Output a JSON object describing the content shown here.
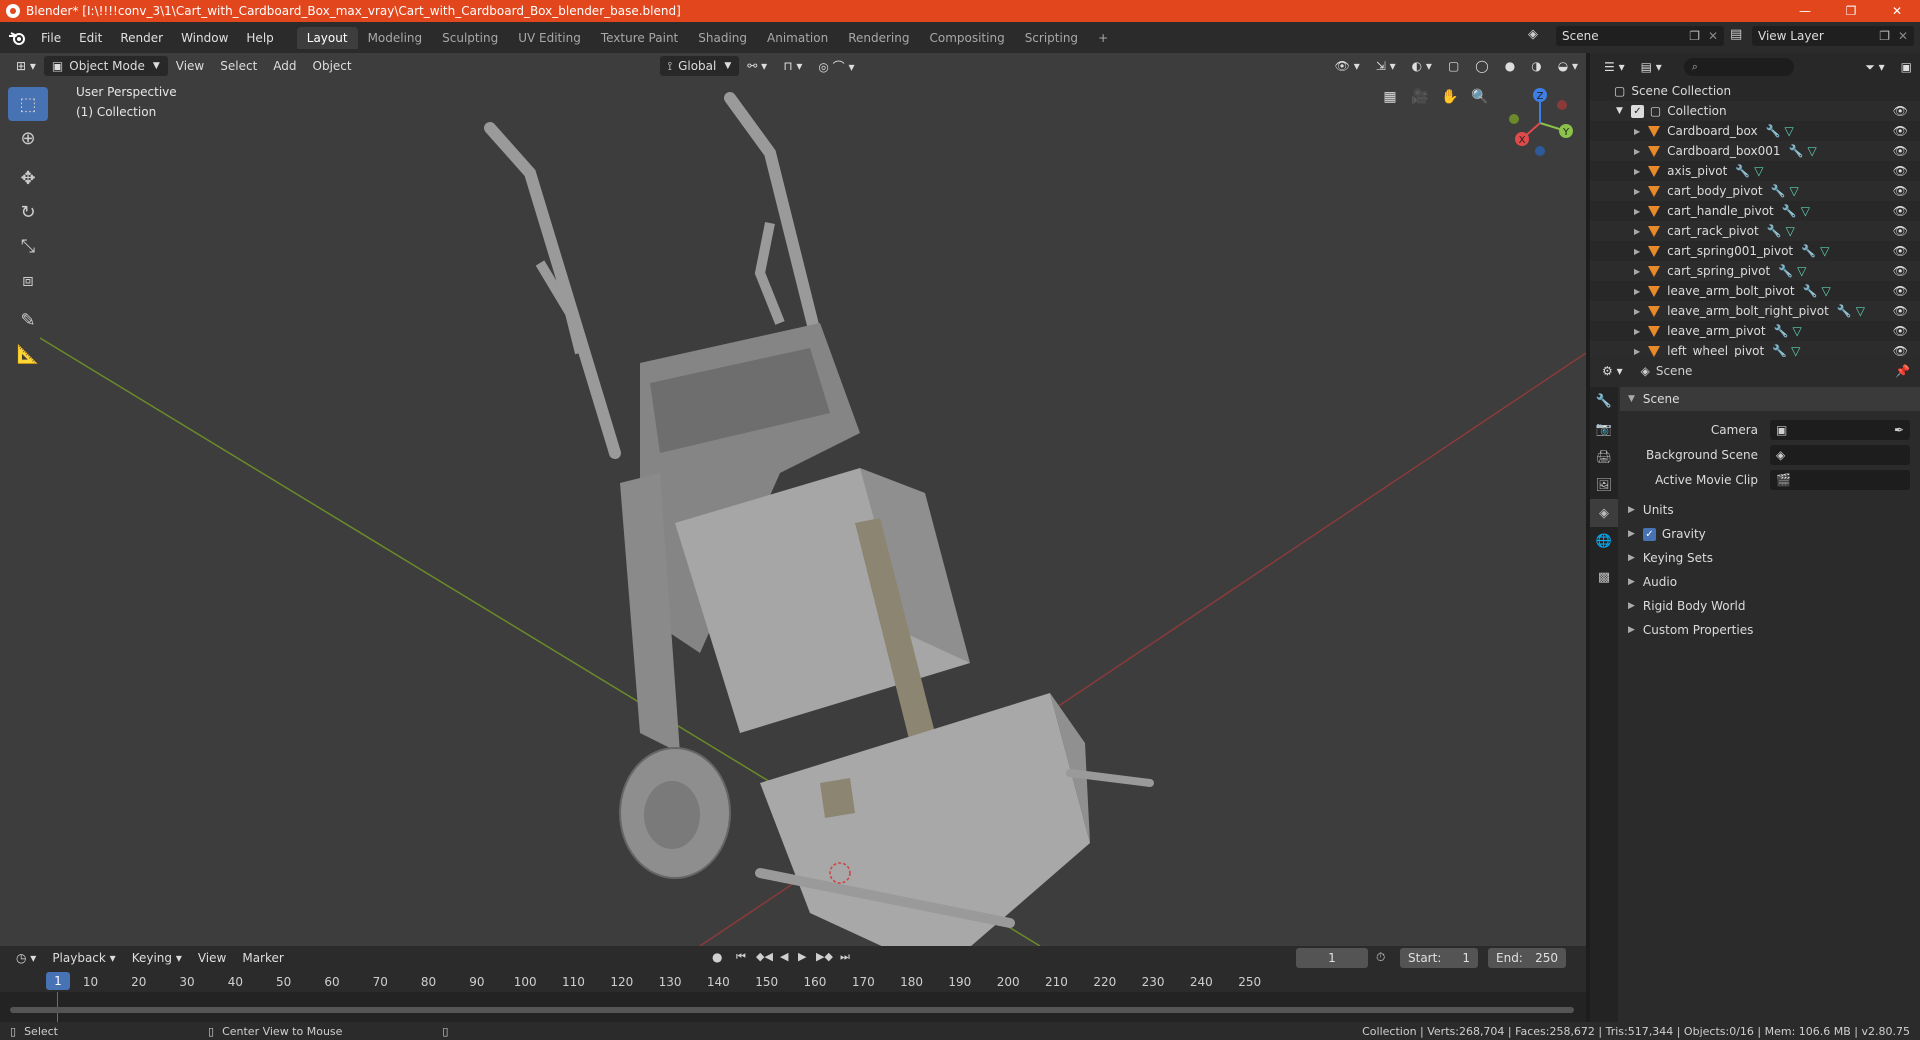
{
  "window": {
    "title": "Blender* [I:\\!!!!conv_3\\1\\Cart_with_Cardboard_Box_max_vray\\Cart_with_Cardboard_Box_blender_base.blend]",
    "minimize": "—",
    "maximize": "❐",
    "close": "✕"
  },
  "menu": [
    "File",
    "Edit",
    "Render",
    "Window",
    "Help"
  ],
  "workspaces": [
    "Layout",
    "Modeling",
    "Sculpting",
    "UV Editing",
    "Texture Paint",
    "Shading",
    "Animation",
    "Rendering",
    "Compositing",
    "Scripting"
  ],
  "scene_selector": "Scene",
  "view_layer_selector": "View Layer",
  "viewport": {
    "mode": "Object Mode",
    "menus": [
      "View",
      "Select",
      "Add",
      "Object"
    ],
    "orientation": "Global",
    "perspective": "User Perspective",
    "collection": "(1) Collection",
    "gizmo_axes": {
      "x": "X",
      "y": "Y",
      "z": "Z"
    },
    "colors": {
      "bg": "#3d3d3d",
      "grid_x": "#8a3a3a",
      "grid_y": "#6b8a2a",
      "model": "#9a9a9a",
      "active_tool": "#4772b3"
    }
  },
  "timeline": {
    "menus": [
      "Playback",
      "Keying",
      "View",
      "Marker"
    ],
    "current_frame": "1",
    "start_label": "Start:",
    "start": "1",
    "end_label": "End:",
    "end": "250",
    "ruler": [
      "1",
      "10",
      "20",
      "30",
      "40",
      "50",
      "60",
      "70",
      "80",
      "90",
      "100",
      "110",
      "120",
      "130",
      "140",
      "150",
      "160",
      "170",
      "180",
      "190",
      "200",
      "210",
      "220",
      "230",
      "240",
      "250"
    ]
  },
  "status": {
    "left_action": "Select",
    "middle_action": "Center View to Mouse",
    "stats": "Collection | Verts:268,704 | Faces:258,672 | Tris:517,344 | Objects:0/16 | Mem: 106.6 MB | v2.80.75"
  },
  "outliner": {
    "scene_collection": "Scene Collection",
    "collection": "Collection",
    "items": [
      "Cardboard_box",
      "Cardboard_box001",
      "axis_pivot",
      "cart_body_pivot",
      "cart_handle_pivot",
      "cart_rack_pivot",
      "cart_spring001_pivot",
      "cart_spring_pivot",
      "leave_arm_bolt_pivot",
      "leave_arm_bolt_right_pivot",
      "leave_arm_pivot",
      "left_wheel_pivot"
    ]
  },
  "properties": {
    "context": "Scene",
    "panel_title": "Scene",
    "fields": [
      {
        "label": "Camera"
      },
      {
        "label": "Background Scene"
      },
      {
        "label": "Active Movie Clip"
      }
    ],
    "sections": [
      "Units",
      "Gravity",
      "Keying Sets",
      "Audio",
      "Rigid Body World",
      "Custom Properties"
    ]
  }
}
